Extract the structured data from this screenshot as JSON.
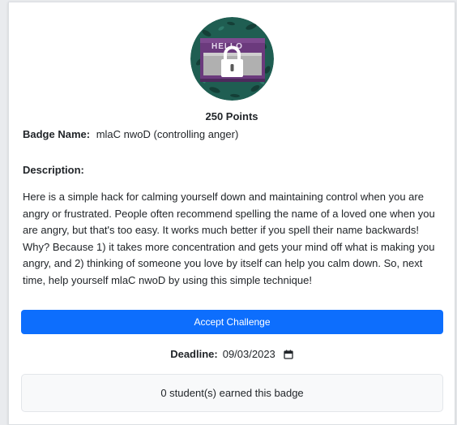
{
  "badge": {
    "image_icon": "hello-name-tag-lock-icon",
    "points": "250 Points",
    "name_label": "Badge Name:",
    "name_value": "mlaC nwoD (controlling anger)",
    "description_label": "Description:",
    "description": "Here is a simple hack for calming yourself down and maintaining control when you are angry or frustrated. People often recommend spelling the name of a loved one when you are angry, but that's too easy. It works much better if you spell their name backwards! Why? Because 1) it takes more concentration and gets your mind off what is making you angry, and 2) thinking of someone you love by itself can help you calm down. So, next time, help yourself mlaC nwoD by using this simple technique!"
  },
  "actions": {
    "accept_label": "Accept Challenge"
  },
  "deadline": {
    "label": "Deadline:",
    "date": "09/03/2023",
    "icon": "calendar-icon"
  },
  "earned": {
    "text": "0 student(s) earned this badge"
  },
  "colors": {
    "primary": "#0d6efd",
    "badge_bg": "#1f5e52",
    "tag_purple": "#6b3a7d"
  }
}
